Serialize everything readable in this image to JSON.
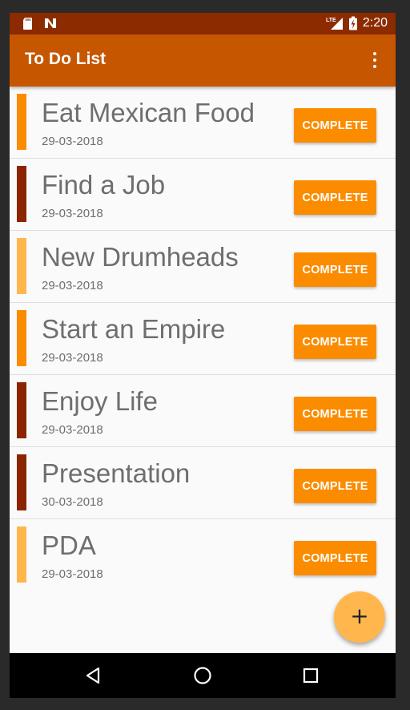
{
  "status_bar": {
    "icons": [
      "sd-card-icon",
      "n-notification-icon",
      "lte-signal-icon",
      "battery-charging-icon"
    ],
    "lte_label": "LTE",
    "time": "2:20"
  },
  "app_bar": {
    "title": "To Do List",
    "menu_icon": "overflow-menu-icon"
  },
  "tasks": [
    {
      "title": "Eat Mexican Food",
      "date": "29-03-2018",
      "priority_color": "#fb8c00",
      "button": "COMPLETE"
    },
    {
      "title": "Find a Job",
      "date": "29-03-2018",
      "priority_color": "#8b2500",
      "button": "COMPLETE"
    },
    {
      "title": "New Drumheads",
      "date": "29-03-2018",
      "priority_color": "#ffb74d",
      "button": "COMPLETE"
    },
    {
      "title": "Start an Empire",
      "date": "29-03-2018",
      "priority_color": "#fb8c00",
      "button": "COMPLETE"
    },
    {
      "title": "Enjoy Life",
      "date": "29-03-2018",
      "priority_color": "#8b2500",
      "button": "COMPLETE"
    },
    {
      "title": "Presentation",
      "date": "30-03-2018",
      "priority_color": "#8b2500",
      "button": "COMPLETE"
    },
    {
      "title": "PDA",
      "date": "29-03-2018",
      "priority_color": "#ffb74d",
      "button": "COMPLETE"
    }
  ],
  "fab": {
    "label": "+",
    "icon": "add-icon"
  },
  "nav_bar": {
    "icons": [
      "back-icon",
      "home-icon",
      "recents-icon"
    ]
  },
  "colors": {
    "status_bar": "#8c2a00",
    "app_bar": "#c65600",
    "accent": "#fb8c00",
    "fab": "#ffb74d"
  }
}
